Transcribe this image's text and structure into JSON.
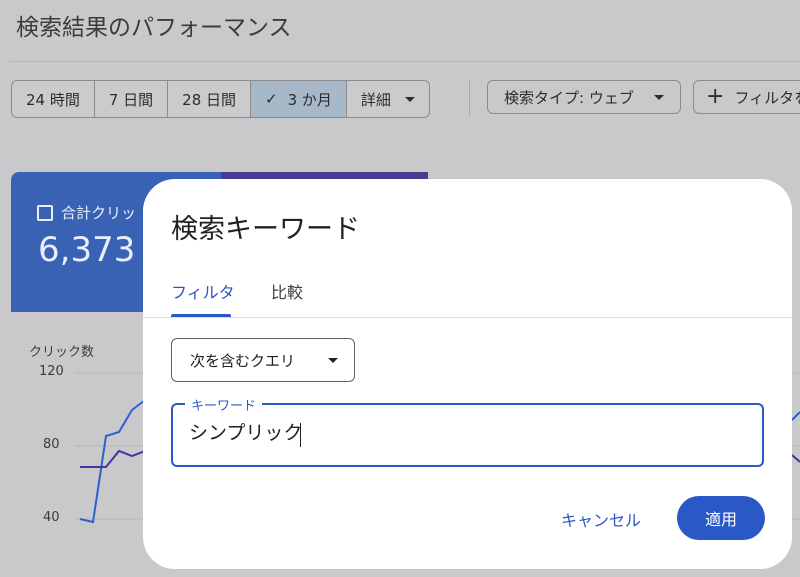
{
  "page": {
    "title": "検索結果のパフォーマンス"
  },
  "date_range": {
    "options": [
      "24 時間",
      "7 日間",
      "28 日間",
      "3 か月",
      "詳細"
    ],
    "selected": "3 か月"
  },
  "filters": {
    "search_type": "検索タイプ: ウェブ",
    "add_filter": "フィルタを"
  },
  "metric_card": {
    "label": "合計クリッ",
    "value": "6,373"
  },
  "chart": {
    "ylabel": "クリック数",
    "yticks": [
      "120",
      "80",
      "40"
    ],
    "colors": {
      "clicks": "#2e5fd0",
      "impressions": "#4b2f9c"
    }
  },
  "dialog": {
    "title": "検索キーワード",
    "tabs": [
      "フィルタ",
      "比較"
    ],
    "match_type": "次を含むクエリ",
    "keyword_label": "キーワード",
    "keyword_value": "シンプリック",
    "cancel": "キャンセル",
    "apply": "適用"
  },
  "colors": {
    "accent": "#2a58c6",
    "overlay": "#c9c9cb",
    "card_blue": "#3a62b4",
    "card_purple": "#4a3a8e"
  }
}
